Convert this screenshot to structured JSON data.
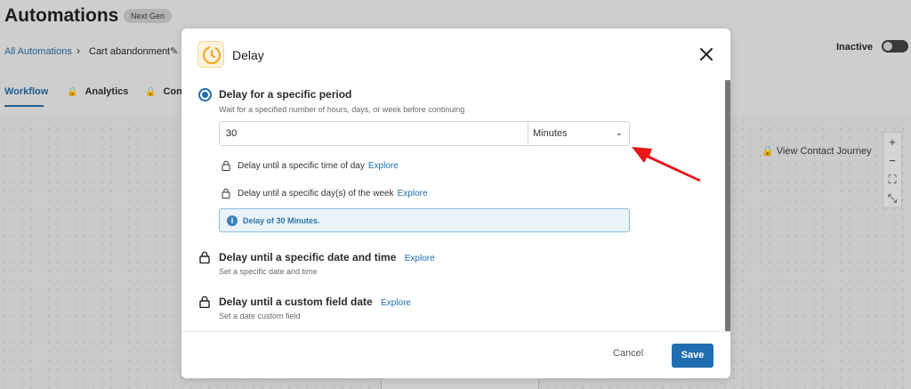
{
  "background": {
    "title": "Automations",
    "badge": "Next Gen",
    "breadcrumb": {
      "link": "All Automations",
      "separator": "›",
      "current": "Cart abandonment"
    },
    "status": "Inactive",
    "tabs": [
      {
        "label": "Workflow"
      },
      {
        "label": "Analytics"
      },
      {
        "label": "Cont"
      }
    ],
    "view_journey": "View Contact Journey",
    "zoom_controls": [
      "+",
      "−",
      "⛶",
      "⤡"
    ]
  },
  "modal": {
    "title": "Delay",
    "close_label": "✕",
    "options": {
      "specific_period": {
        "title": "Delay for a specific period",
        "description": "Wait for a specified number of hours, days, or week before continuing",
        "selected": true,
        "amount_value": "30",
        "unit_value": "Minutes",
        "locked_rows": [
          {
            "label": "Delay until a specific time of day",
            "link": "Explore"
          },
          {
            "label": "Delay until a specific day(s) of the week",
            "link": "Explore"
          }
        ],
        "info": "Delay of 30 Minutes."
      },
      "date_time": {
        "title": "Delay until a specific date and time",
        "link": "Explore",
        "description": "Set a specific date and time"
      },
      "custom_field": {
        "title": "Delay until a custom field date",
        "link": "Explore",
        "description": "Set a date custom field"
      }
    },
    "footer": {
      "cancel": "Cancel",
      "save": "Save"
    }
  },
  "colors": {
    "accent": "#1f6fb0",
    "annotation_arrow": "#e8151b",
    "icon_orange": "#f0a31c"
  }
}
